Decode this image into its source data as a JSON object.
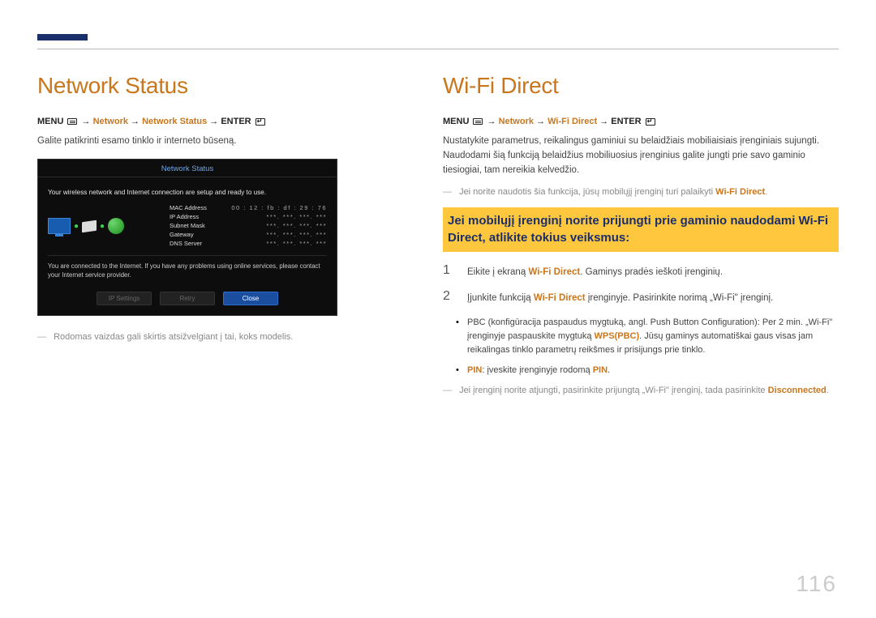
{
  "navStub": "",
  "pageNumber": "116",
  "left": {
    "heading": "Network Status",
    "breadcrumb": {
      "menu": "MENU",
      "path1": "Network",
      "path2": "Network Status",
      "enter": "ENTER"
    },
    "p1": "Galite patikrinti esamo tinklo ir interneto būseną.",
    "dialog": {
      "title": "Network Status",
      "msg": "Your wireless network and Internet connection are setup and ready to use.",
      "fields": {
        "mac": {
          "label": "MAC Address",
          "val": "00 : 12 : fb : df : 29 : 76"
        },
        "ip": {
          "label": "IP Address",
          "val": "***.   ***.   ***.   ***"
        },
        "mask": {
          "label": "Subnet Mask",
          "val": "***.   ***.   ***.   ***"
        },
        "gw": {
          "label": "Gateway",
          "val": "***.   ***.   ***.   ***"
        },
        "dns": {
          "label": "DNS Server",
          "val": "***.   ***.   ***.   ***"
        }
      },
      "footnote": "You are connected to the Internet. If you have any problems using online services, please contact your Internet service provider.",
      "buttons": {
        "ip": "IP Settings",
        "retry": "Retry",
        "close": "Close"
      }
    },
    "note1": "Rodomas vaizdas gali skirtis atsižvelgiant į tai, koks modelis."
  },
  "right": {
    "heading": "Wi-Fi Direct",
    "breadcrumb": {
      "menu": "MENU",
      "path1": "Network",
      "path2": "Wi-Fi Direct",
      "enter": "ENTER"
    },
    "p1": "Nustatykite parametrus, reikalingus gaminiui su belaidžiais mobiliaisiais įrenginiais sujungti. Naudodami šią funkciją belaidžius mobiliuosius įrenginius galite jungti prie savo gaminio tiesiogiai, tam nereikia kelvedžio.",
    "note1_pre": "Jei norite naudotis šia funkcija, jūsų mobilųjį įrenginį turi palaikyti ",
    "note1_accent": "Wi-Fi Direct",
    "note1_post": ".",
    "highlight": "Jei mobilųjį įrenginį norite prijungti prie gaminio naudodami Wi-Fi Direct, atlikite tokius veiksmus:",
    "step1_pre": "Eikite į ekraną ",
    "step1_accent": "Wi-Fi Direct",
    "step1_post": ". Gaminys pradės ieškoti įrenginių.",
    "step2_pre": "Įjunkite funkciją ",
    "step2_accent": "Wi-Fi Direct",
    "step2_post": " įrenginyje. Pasirinkite norimą „Wi-Fi\" įrenginį.",
    "bullet1_pre": "PBC (konfigūracija paspaudus mygtuką, angl. Push Button Configuration): Per 2 min. „Wi-Fi\" įrenginyje paspauskite mygtuką ",
    "bullet1_accent": "WPS(PBC)",
    "bullet1_post": ". Jūsų gaminys automatiškai gaus visas jam reikalingas tinklo parametrų reikšmes ir prisijungs prie tinklo.",
    "bullet2_accent1": "PIN",
    "bullet2_mid": ": įveskite įrenginyje rodomą ",
    "bullet2_accent2": "PIN",
    "bullet2_post": ".",
    "note2_pre": "Jei įrenginį norite atjungti, pasirinkite prijungtą „Wi-Fi\" įrenginį, tada pasirinkite ",
    "note2_accent": "Disconnected",
    "note2_post": "."
  }
}
